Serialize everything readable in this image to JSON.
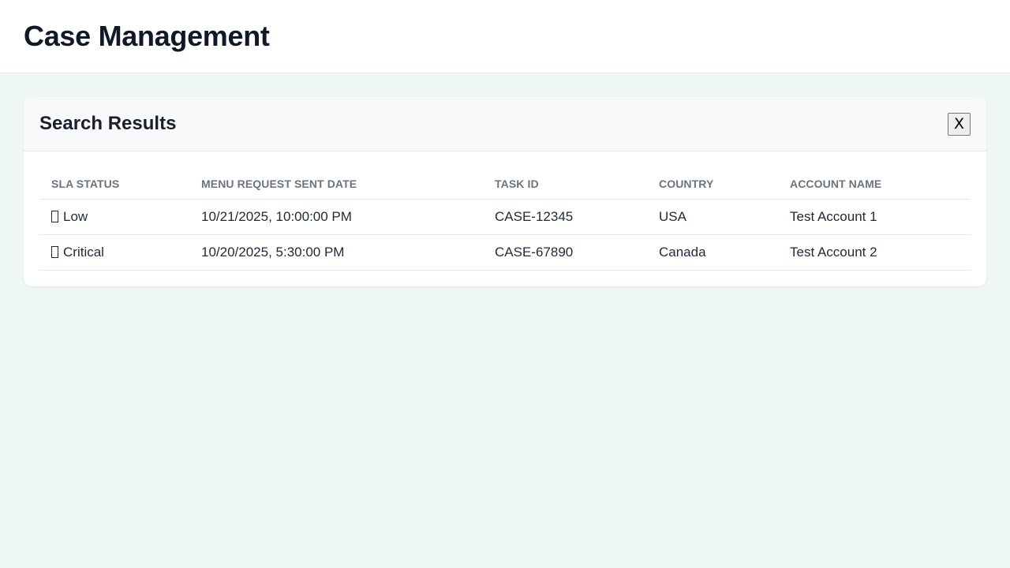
{
  "header": {
    "title": "Case Management"
  },
  "results": {
    "title": "Search Results",
    "close_label": "X",
    "columns": [
      "SLA STATUS",
      "MENU REQUEST SENT DATE",
      "TASK ID",
      "COUNTRY",
      "ACCOUNT NAME"
    ],
    "rows": [
      {
        "sla_status": "Low",
        "sla_icon": "missing-glyph-icon",
        "sent_date": "10/21/2025, 10:00:00 PM",
        "task_id": "CASE-12345",
        "country": "USA",
        "account_name": "Test Account 1"
      },
      {
        "sla_status": "Critical",
        "sla_icon": "missing-glyph-icon",
        "sent_date": "10/20/2025, 5:30:00 PM",
        "task_id": "CASE-67890",
        "country": "Canada",
        "account_name": "Test Account 2"
      }
    ]
  },
  "colors": {
    "page_background": "#eff7f4",
    "card_header_background": "#f7f9fa",
    "title_text": "#111827",
    "column_header_text": "#6b7280"
  }
}
